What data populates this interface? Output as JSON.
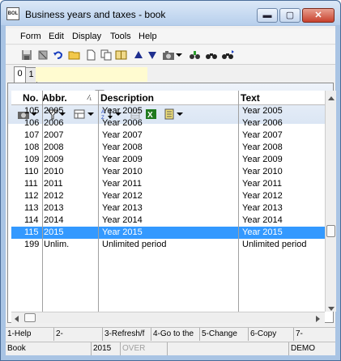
{
  "window": {
    "title": "Business years and taxes - book",
    "app_icon_label": "BOL"
  },
  "window_controls": {
    "minimize": "▬",
    "maximize": "▢",
    "close": "✕"
  },
  "menu": [
    "Form",
    "Edit",
    "Display",
    "Tools",
    "Help"
  ],
  "tabs": [
    "0",
    "1"
  ],
  "grid": {
    "columns": {
      "no": "No.",
      "abbr": "Abbr.",
      "sort_marker": "⁄₁",
      "description": "Description",
      "text": "Text"
    },
    "rows": [
      {
        "no": "105",
        "abbr": "2005",
        "description": "Year 2005",
        "text": "Year 2005"
      },
      {
        "no": "106",
        "abbr": "2006",
        "description": "Year 2006",
        "text": "Year 2006"
      },
      {
        "no": "107",
        "abbr": "2007",
        "description": "Year 2007",
        "text": "Year 2007"
      },
      {
        "no": "108",
        "abbr": "2008",
        "description": "Year 2008",
        "text": "Year 2008"
      },
      {
        "no": "109",
        "abbr": "2009",
        "description": "Year 2009",
        "text": "Year 2009"
      },
      {
        "no": "110",
        "abbr": "2010",
        "description": "Year 2010",
        "text": "Year 2010"
      },
      {
        "no": "111",
        "abbr": "2011",
        "description": "Year 2011",
        "text": "Year 2011"
      },
      {
        "no": "112",
        "abbr": "2012",
        "description": "Year 2012",
        "text": "Year 2012"
      },
      {
        "no": "113",
        "abbr": "2013",
        "description": "Year 2013",
        "text": "Year 2013"
      },
      {
        "no": "114",
        "abbr": "2014",
        "description": "Year 2014",
        "text": "Year 2014"
      },
      {
        "no": "115",
        "abbr": "2015",
        "description": "Year 2015",
        "text": "Year 2015"
      },
      {
        "no": "199",
        "abbr": "Unlim.",
        "description": "Unlimited period",
        "text": "Unlimited period"
      }
    ],
    "selected_row": 10
  },
  "function_keys": [
    "1-Help",
    "2-",
    "3-Refresh/f",
    "4-Go to the",
    "5-Change",
    "6-Copy",
    "7-"
  ],
  "status": {
    "form": "Book",
    "year": "2015",
    "mode": "OVER",
    "company": "DEMO"
  },
  "colors": {
    "selection": "#3399ff",
    "title_gradient_top": "#dbe8f7",
    "tab_field": "#fffbd0"
  }
}
